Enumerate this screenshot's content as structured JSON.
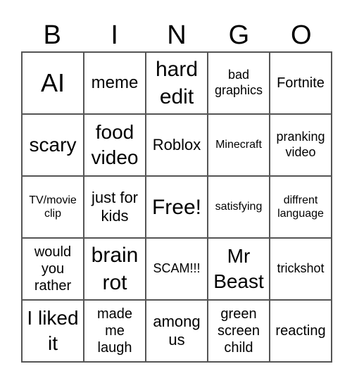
{
  "header": [
    "B",
    "I",
    "N",
    "G",
    "O"
  ],
  "cells": [
    "AI",
    "meme",
    "hard edit",
    "bad graphics",
    "Fortnite",
    "scary",
    "food video",
    "Roblox",
    "Minecraft",
    "pranking video",
    "TV/movie clip",
    "just for kids",
    "Free!",
    "satisfying",
    "diffrent language",
    "would you rather",
    "brain rot",
    "SCAM!!!",
    "Mr Beast",
    "trickshot",
    "I liked it",
    "made me laugh",
    "among us",
    "green screen child",
    "reacting"
  ]
}
